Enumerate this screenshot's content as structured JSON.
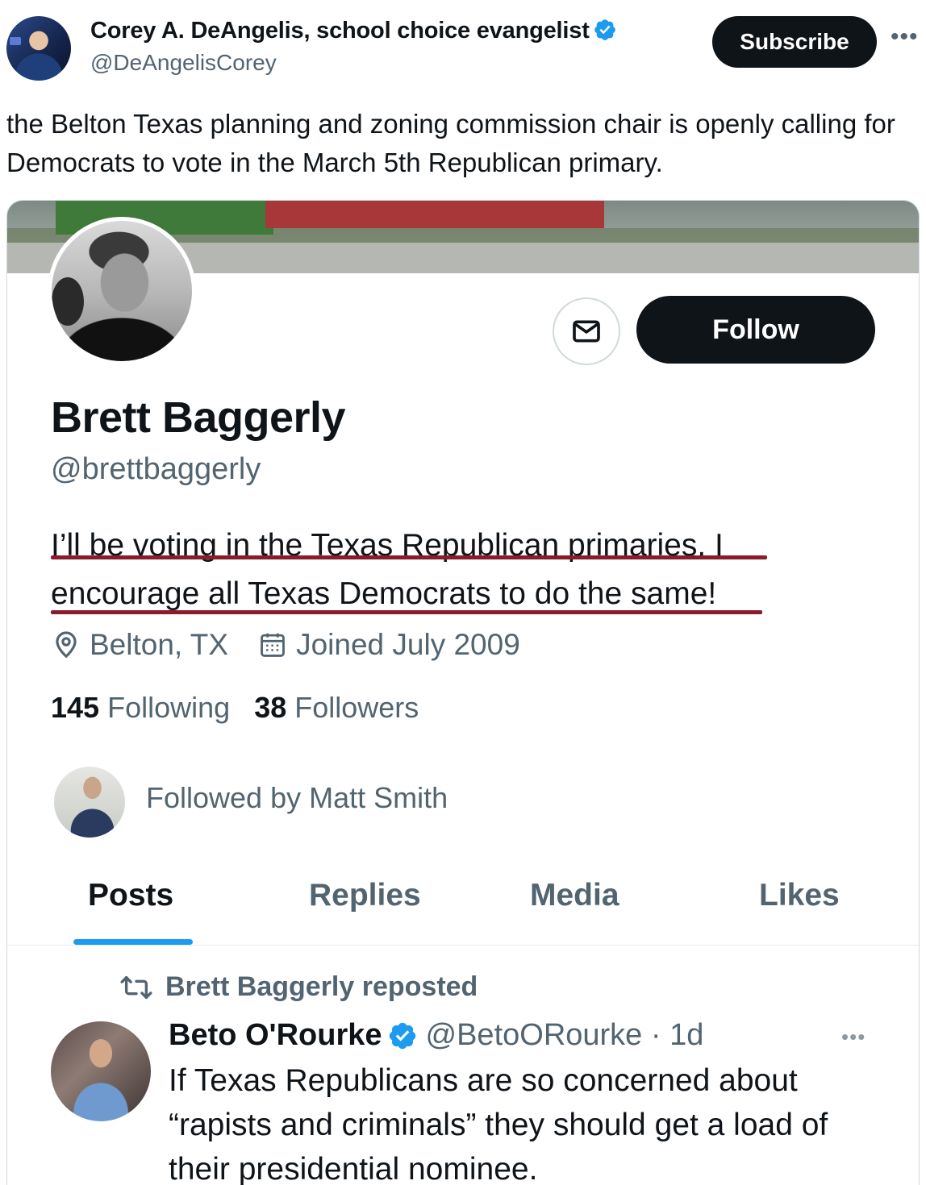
{
  "outer_tweet": {
    "author_name": "Corey A. DeAngelis, school choice evangelist",
    "author_handle": "@DeAngelisCorey",
    "subscribe_label": "Subscribe",
    "more_label": "•••",
    "text": "the Belton Texas planning and zoning commission chair is openly calling for Democrats to vote in the March 5th Republican primary."
  },
  "profile": {
    "follow_label": "Follow",
    "name": "Brett Baggerly",
    "handle": "@brettbaggerly",
    "bio_line1": "I’ll be voting in the Texas Republican primaries. I",
    "bio_line2": "encourage all Texas Democrats to do the same!",
    "location": "Belton, TX",
    "joined": "Joined July 2009",
    "following_count": "145",
    "following_label": "Following",
    "followers_count": "38",
    "followers_label": "Followers",
    "followed_by": "Followed by Matt Smith"
  },
  "tabs": [
    {
      "label": "Posts",
      "active": true
    },
    {
      "label": "Replies",
      "active": false
    },
    {
      "label": "Media",
      "active": false
    },
    {
      "label": "Likes",
      "active": false
    }
  ],
  "repost": {
    "label": "Brett Baggerly reposted",
    "author_name": "Beto O'Rourke",
    "author_handle_time": "@BetoORourke · 1d",
    "more_label": "•••",
    "text": "If Texas Republicans are so concerned about “rapists and criminals” they should get a load of their presidential nominee."
  },
  "colors": {
    "accent": "#1d9bf0",
    "verified": "#1d9bf0",
    "underline": "#8b1a2b",
    "button_dark": "#0f1419",
    "secondary_text": "#536471"
  },
  "icons": {
    "verified": "verified-badge-icon",
    "message": "envelope-icon",
    "location": "location-pin-icon",
    "calendar": "calendar-icon",
    "repost": "repost-icon",
    "more": "more-horizontal-icon"
  }
}
